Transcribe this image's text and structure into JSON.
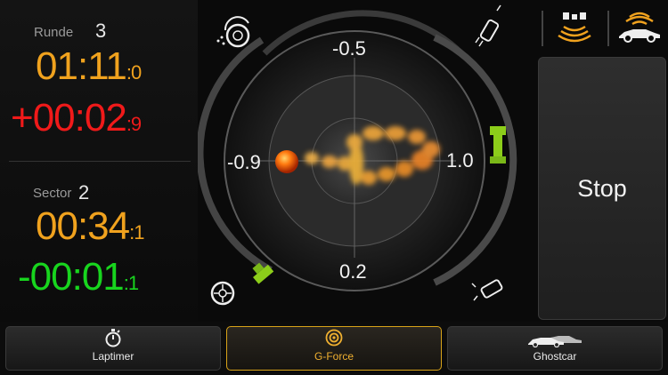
{
  "lap": {
    "label": "Runde",
    "number": "3",
    "time_main": "01:11",
    "time_frac": ":0",
    "delta_main": "+00:02",
    "delta_frac": ":9"
  },
  "sector": {
    "label": "Sector",
    "number": "2",
    "time_main": "00:34",
    "time_frac": ":1",
    "delta_main": "-00:01",
    "delta_frac": ":1"
  },
  "gforce": {
    "top_value": "-0.5",
    "bottom_value": "0.2",
    "left_value": "-0.9",
    "right_value": "1.0"
  },
  "icons": {
    "top_left": "wheel-spin-icon",
    "top_right": "car-drift-icon",
    "bottom_left": "wheel-icon",
    "bottom_right": "car-skid-icon",
    "signal": "gps-signal-icon",
    "car_signal": "car-signal-icon"
  },
  "stop_button": {
    "label": "Stop"
  },
  "tabs": [
    {
      "label": "Laptimer",
      "icon": "stopwatch-icon",
      "active": false
    },
    {
      "label": "G-Force",
      "icon": "target-icon",
      "active": true
    },
    {
      "label": "Ghostcar",
      "icon": "two-cars-icon",
      "active": false
    }
  ],
  "colors": {
    "orange": "#f0a21e",
    "red": "#f01a1a",
    "green": "#18d51e",
    "accent": "#d9a318"
  }
}
